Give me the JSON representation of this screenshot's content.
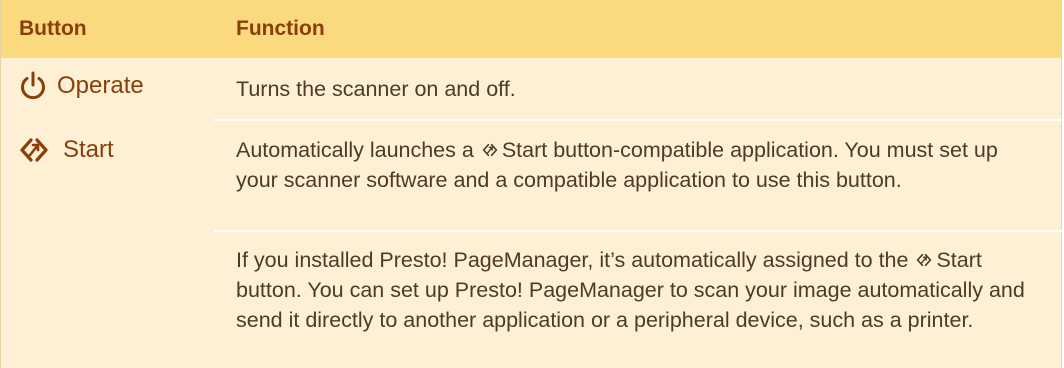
{
  "header": {
    "col1": "Button",
    "col2": "Function"
  },
  "rows": [
    {
      "button_label": "Operate",
      "icon": "power-icon",
      "function": "Turns the scanner on and off."
    },
    {
      "button_label": "Start",
      "icon": "start-button-icon",
      "function_before_icon": "Automatically launches a",
      "function_after_icon": "Start button-compatible application. You must set up your scanner software and a compatible application to use this button."
    },
    {
      "function_before_icon": "If you installed Presto! PageManager, it’s automatically assigned to the",
      "function_after_icon": "Start button. You can set up Presto! PageManager to scan your image automatically and send it directly to another application or a peripheral device, such as a printer."
    }
  ],
  "colors": {
    "header_bg": "#fbda7f",
    "body_bg": "#fdf0d4",
    "accent": "#8b3e0b"
  }
}
